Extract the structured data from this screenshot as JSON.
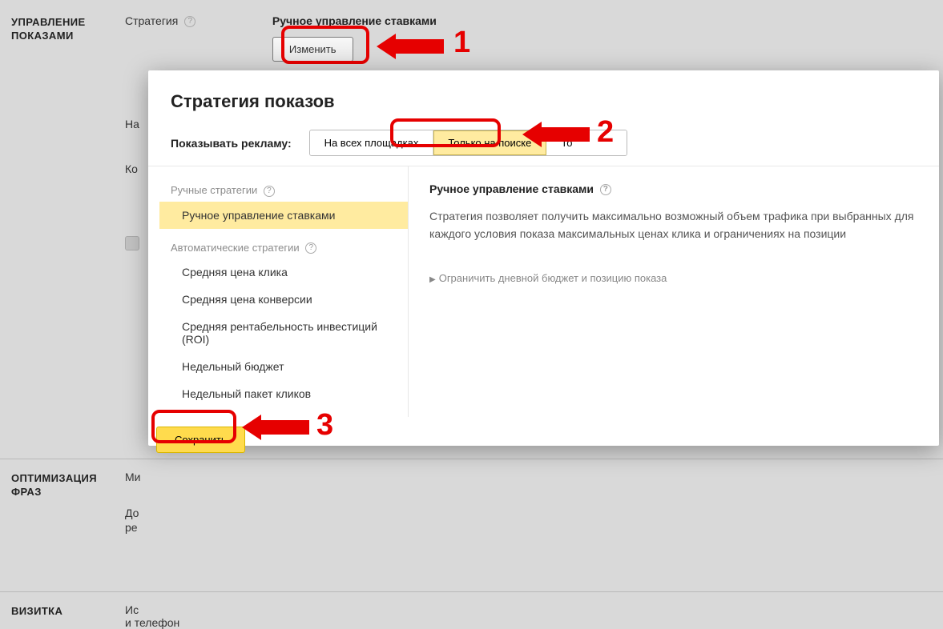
{
  "page": {
    "section1": {
      "label": "УПРАВЛЕНИЕ ПОКАЗАМИ",
      "field_label": "Стратегия",
      "strategy_title": "Ручное управление ставками",
      "change_btn": "Изменить",
      "row2_label_stub": "На",
      "row3_label_stub": "Ко"
    },
    "section2": {
      "label": "ОПТИМИЗАЦИЯ ФРАЗ",
      "field_label_stub": "Ми",
      "row2a": "До",
      "row2b": "ре"
    },
    "section3": {
      "label": "ВИЗИТКА",
      "field_label_stub": "Ис",
      "field_label_sub": "и телефон"
    }
  },
  "annotations": {
    "n1": "1",
    "n2": "2",
    "n3": "3"
  },
  "modal": {
    "title": "Стратегия показов",
    "show_label": "Показывать рекламу:",
    "seg": [
      "На всех площадках",
      "Только на поиске",
      "То"
    ],
    "group1": "Ручные стратегии",
    "group2": "Автоматические стратегии",
    "manual_item": "Ручное управление ставками",
    "auto_items": [
      "Средняя цена клика",
      "Средняя цена конверсии",
      "Средняя рентабельность инвестиций (ROI)",
      "Недельный бюджет",
      "Недельный пакет кликов"
    ],
    "right_title": "Ручное управление ставками",
    "right_desc": "Стратегия позволяет получить максимально возможный объем трафика при выбранных для каждого условия показа максимальных ценах клика и ограничениях на позиции",
    "accordion": "Ограничить дневной бюджет и позицию показа",
    "save": "Сохранить"
  }
}
